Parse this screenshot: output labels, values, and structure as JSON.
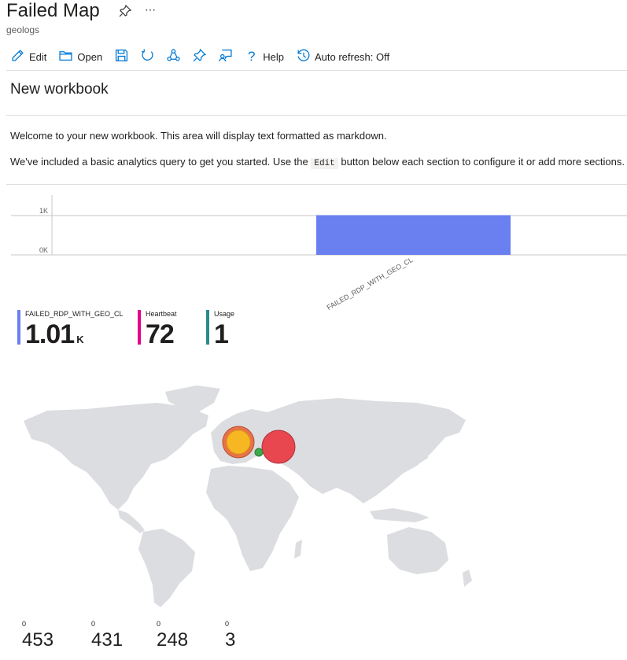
{
  "header": {
    "title": "Failed Map",
    "subtitle": "geologs"
  },
  "toolbar": {
    "edit_label": "Edit",
    "open_label": "Open",
    "help_label": "Help",
    "autorefresh_label": "Auto refresh: Off"
  },
  "workbook": {
    "title": "New workbook",
    "line1": "Welcome to your new workbook. This area will display text formatted as markdown.",
    "line2_pre": "We've included a basic analytics query to get you started. Use the",
    "line2_code": "Edit",
    "line2_post": "button below each section to configure it or add more sections."
  },
  "chart_data": {
    "type": "bar",
    "categories": [
      "FAILED_RDP_WITH_GEO_CL"
    ],
    "values": [
      1010
    ],
    "yticks": [
      "1K",
      "0K"
    ],
    "ylim": [
      0,
      1000
    ],
    "bar_color": "#6a7ff0"
  },
  "tiles": [
    {
      "name": "FAILED_RDP_WITH_GEO_CL",
      "value": "1.01",
      "unit": "K",
      "color": "#6a7ff0"
    },
    {
      "name": "Heartbeat",
      "value": "72",
      "unit": "",
      "color": "#e3008c"
    },
    {
      "name": "Usage",
      "value": "1",
      "unit": "",
      "color": "#2a8a8e"
    }
  ],
  "map": {
    "points": [
      {
        "color": "#e8474f",
        "size": "large"
      },
      {
        "color": "#f7b723",
        "ring": "#e8724a",
        "size": "medium"
      },
      {
        "color": "#3ea84a",
        "size": "small"
      }
    ]
  },
  "stats": [
    {
      "label": "0",
      "value": "453"
    },
    {
      "label": "0",
      "value": "431"
    },
    {
      "label": "0",
      "value": "248"
    },
    {
      "label": "0",
      "value": "3"
    }
  ]
}
